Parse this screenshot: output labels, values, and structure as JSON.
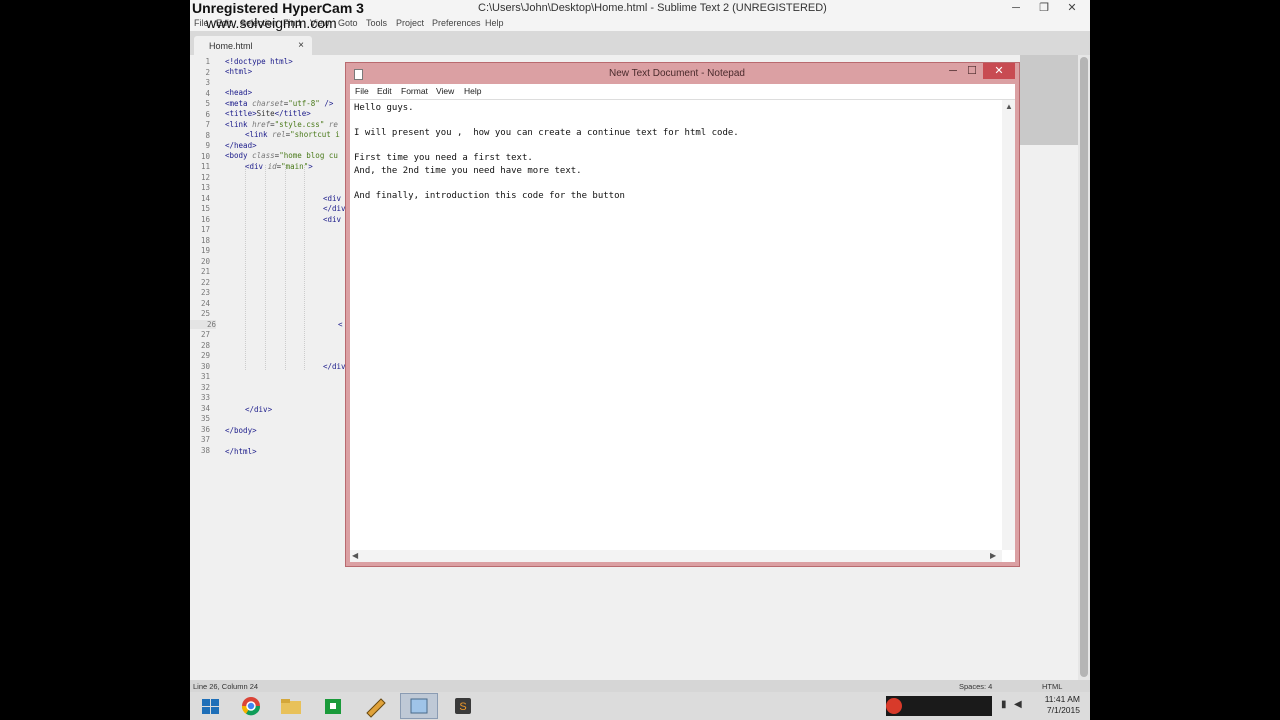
{
  "watermark": {
    "line1": "Unregistered HyperCam 3",
    "line2": "www.solveigmm.com"
  },
  "sublime": {
    "title": "C:\\Users\\John\\Desktop\\Home.html - Sublime Text 2 (UNREGISTERED)",
    "menu": [
      "File",
      "Edit",
      "Selection",
      "Find",
      "View",
      "Goto",
      "Tools",
      "Project",
      "Preferences",
      "Help"
    ],
    "tab_label": "Home.html",
    "tab_close": "×",
    "line_numbers": [
      "1",
      "2",
      "3",
      "4",
      "5",
      "6",
      "7",
      "8",
      "9",
      "10",
      "11",
      "12",
      "13",
      "14",
      "15",
      "16",
      "17",
      "18",
      "19",
      "20",
      "21",
      "22",
      "23",
      "24",
      "25",
      "26",
      "27",
      "28",
      "29",
      "30",
      "31",
      "32",
      "33",
      "34",
      "35",
      "36",
      "37",
      "38"
    ],
    "status_left": "Line 26, Column 24",
    "status_spaces": "Spaces: 4",
    "status_syntax": "HTML"
  },
  "notepad": {
    "title": "New Text Document - Notepad",
    "menu": [
      "File",
      "Edit",
      "Format",
      "View",
      "Help"
    ],
    "lines": [
      "Hello guys.",
      "",
      "I will present you ,  how you can create a continue text for html code.",
      "",
      "First time you need a first text.",
      "And, the 2nd time you need have more text.",
      "",
      "And finally, introduction this code for the button"
    ]
  },
  "taskbar": {
    "time": "11:41 AM",
    "date": "7/1/2015"
  },
  "colors": {
    "notepad_frame": "#dba0a3",
    "close_button": "#c84b52",
    "taskbar": "#dcdcdc"
  }
}
